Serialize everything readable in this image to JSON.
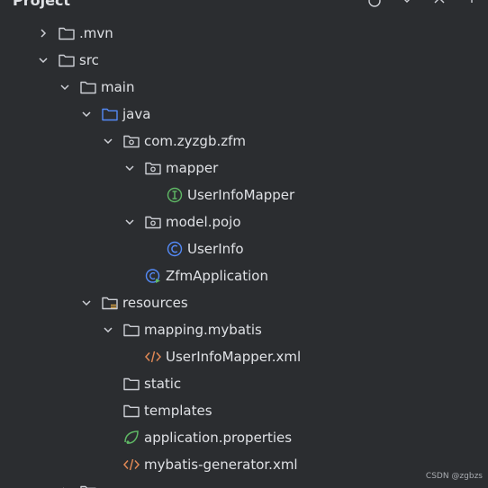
{
  "header": {
    "title": "Project"
  },
  "tree": [
    {
      "label": ".mvn",
      "depth": 0,
      "expand": "collapsed",
      "icon": "folder-icon"
    },
    {
      "label": "src",
      "depth": 0,
      "expand": "expanded",
      "icon": "folder-icon"
    },
    {
      "label": "main",
      "depth": 1,
      "expand": "expanded",
      "icon": "folder-icon"
    },
    {
      "label": "java",
      "depth": 2,
      "expand": "expanded",
      "icon": "source-folder-icon"
    },
    {
      "label": "com.zyzgb.zfm",
      "depth": 3,
      "expand": "expanded",
      "icon": "package-icon"
    },
    {
      "label": "mapper",
      "depth": 4,
      "expand": "expanded",
      "icon": "package-icon"
    },
    {
      "label": "UserInfoMapper",
      "depth": 5,
      "expand": "none",
      "icon": "interface-icon"
    },
    {
      "label": "model.pojo",
      "depth": 4,
      "expand": "expanded",
      "icon": "package-icon"
    },
    {
      "label": "UserInfo",
      "depth": 5,
      "expand": "none",
      "icon": "class-icon"
    },
    {
      "label": "ZfmApplication",
      "depth": 4,
      "expand": "none",
      "icon": "spring-app-icon"
    },
    {
      "label": "resources",
      "depth": 2,
      "expand": "expanded",
      "icon": "resources-folder-icon"
    },
    {
      "label": "mapping.mybatis",
      "depth": 3,
      "expand": "expanded",
      "icon": "folder-icon"
    },
    {
      "label": "UserInfoMapper.xml",
      "depth": 4,
      "expand": "none",
      "icon": "xml-icon"
    },
    {
      "label": "static",
      "depth": 3,
      "expand": "none",
      "icon": "folder-icon"
    },
    {
      "label": "templates",
      "depth": 3,
      "expand": "none",
      "icon": "folder-icon"
    },
    {
      "label": "application.properties",
      "depth": 3,
      "expand": "none",
      "icon": "spring-properties-icon"
    },
    {
      "label": "mybatis-generator.xml",
      "depth": 3,
      "expand": "none",
      "icon": "xml-icon"
    },
    {
      "label": "",
      "depth": 1,
      "expand": "collapsed",
      "icon": "folder-icon"
    }
  ],
  "watermark": "CSDN @zgbzs",
  "colors": {
    "background": "#2b2d30",
    "text": "#dfe1e5",
    "icon_gray": "#ced0d6",
    "accent_blue": "#548af7",
    "interface_green": "#5fb865",
    "xml_orange": "#e08855"
  }
}
